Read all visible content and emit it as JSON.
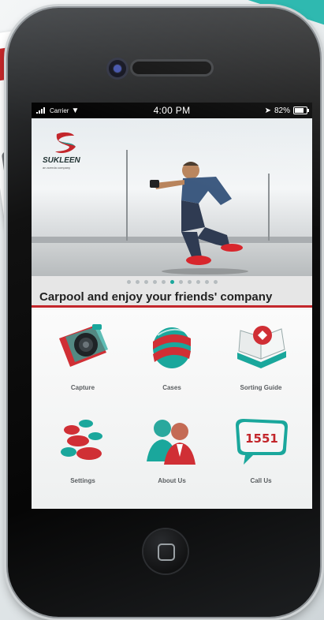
{
  "status_bar": {
    "carrier": "Carrier",
    "time": "4:00 PM",
    "battery": "82%"
  },
  "brand": {
    "name": "SUKLEEN",
    "tagline": "an averda company",
    "accent": "#c3262b",
    "teal": "#1aa79c"
  },
  "slider": {
    "caption": "Carpool and enjoy your friends' company",
    "dot_count": 11,
    "active_index": 5
  },
  "menu": [
    {
      "label": "Capture",
      "icon": "camera-icon"
    },
    {
      "label": "Cases",
      "icon": "cases-icon"
    },
    {
      "label": "Sorting Guide",
      "icon": "sorting-guide-icon"
    },
    {
      "label": "Settings",
      "icon": "settings-icon"
    },
    {
      "label": "About Us",
      "icon": "about-us-icon"
    },
    {
      "label": "Call Us",
      "icon": "call-us-icon"
    }
  ],
  "call_number": "1551"
}
